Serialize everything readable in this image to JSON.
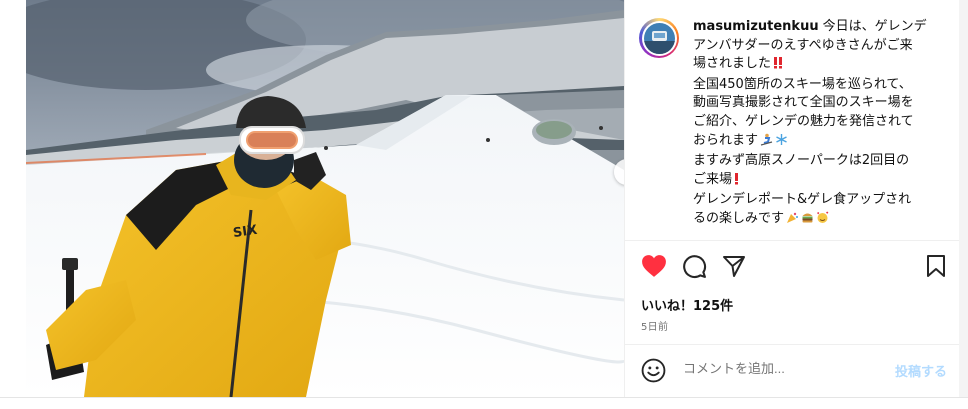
{
  "post": {
    "username": "masumizutenkuu",
    "caption_lines": [
      "今日は、ゲレンデ",
      "アンバサダーのえすぺゆきさんがご来",
      "場されました",
      "全国450箇所のスキー場を巡られて、",
      "動画写真撮影されて全国のスキー場を",
      "ご紹介、ゲレンデの魅力を発信されて",
      "おられます",
      "ますみず高原スノーパークは2回目の",
      "ご来場",
      "ゲレンデレポート&ゲレ食アップされ",
      "るの楽しみです"
    ],
    "likes": "いいね！125件",
    "date": "5日前"
  },
  "jacket_logo": "SIX",
  "comment": {
    "placeholder": "コメントを追加...",
    "post_label": "投稿する"
  },
  "icons": {
    "like": "heart-filled-icon",
    "comment": "comment-icon",
    "share": "paper-plane-icon",
    "save": "bookmark-icon",
    "emoji": "smiley-icon",
    "next": "chevron-right-icon"
  },
  "colors": {
    "like_red": "#ff3040",
    "post_button_disabled": "#b3dbff",
    "muted_text": "#737373"
  }
}
